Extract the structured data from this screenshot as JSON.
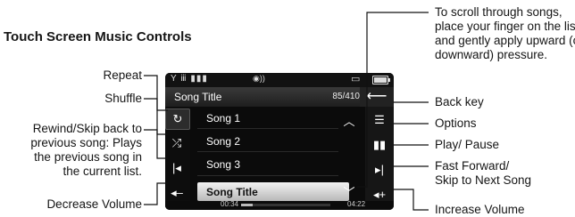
{
  "heading": "Touch Screen Music Controls",
  "screen": {
    "status_signal": "Y ⅲ ▮▮▮",
    "track_count": "85/410",
    "list_title": "Song Title",
    "songs": [
      "Song 1",
      "Song 2",
      "Song 3"
    ],
    "selected_song": "Song Title",
    "elapsed": "00:34",
    "total": "04:22",
    "progress_fraction": 0.13
  },
  "labels": {
    "repeat": "Repeat",
    "shuffle": "Shuffle",
    "rewind": [
      "Rewind/Skip back to",
      "previous song: Plays",
      "the previous song in",
      "the current list."
    ],
    "decrease_volume": "Decrease Volume",
    "scroll_note": [
      "To scroll through songs,",
      "place your finger on the list",
      "and gently apply upward (or",
      "downward) pressure."
    ],
    "back_key": "Back key",
    "options": "Options",
    "play_pause": "Play/ Pause",
    "fast_forward": [
      "Fast Forward/",
      "Skip to Next Song"
    ],
    "increase_volume": "Increase Volume"
  },
  "icons": {
    "back": "back-arrow-icon",
    "repeat": "repeat-icon",
    "shuffle": "shuffle-icon",
    "rewind": "rewind-icon",
    "volume_down": "volume-down-icon",
    "options": "options-icon",
    "play_pause": "play-pause-icon",
    "fast_forward": "fast-forward-icon",
    "volume_up": "volume-up-icon",
    "scroll_up": "chevron-up-icon",
    "scroll_down": "chevron-down-icon"
  }
}
